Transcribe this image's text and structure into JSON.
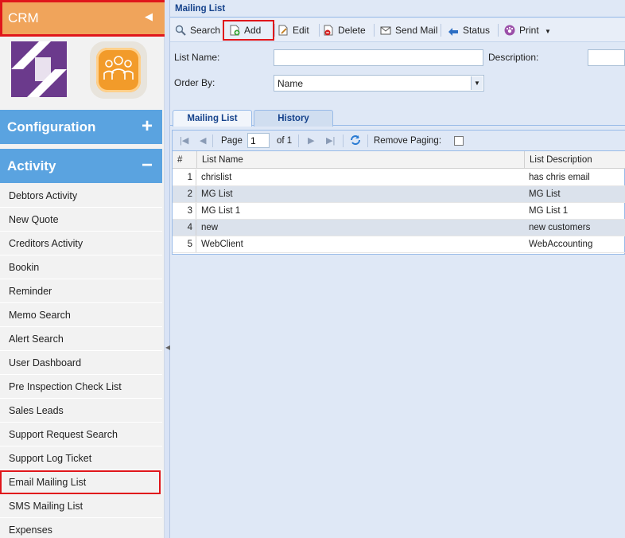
{
  "sidebar": {
    "crm_title": "CRM",
    "sections": [
      {
        "label": "Configuration",
        "sign": "+"
      },
      {
        "label": "Activity",
        "sign": "−"
      }
    ],
    "items": [
      "Debtors Activity",
      "New Quote",
      "Creditors Activity",
      "Bookin",
      "Reminder",
      "Memo Search",
      "Alert Search",
      "User Dashboard",
      "Pre Inspection Check List",
      "Sales Leads",
      "Support Request Search",
      "Support Log Ticket",
      "Email Mailing List",
      "SMS Mailing List",
      "Expenses"
    ]
  },
  "panel": {
    "title": "Mailing List"
  },
  "toolbar": {
    "search": "Search",
    "add": "Add",
    "edit": "Edit",
    "delete": "Delete",
    "send_mail": "Send Mail",
    "status": "Status",
    "print": "Print"
  },
  "form": {
    "list_name_label": "List Name:",
    "list_name_value": "",
    "description_label": "Description:",
    "description_value": "",
    "order_by_label": "Order By:",
    "order_by_value": "Name"
  },
  "tabs": [
    "Mailing List",
    "History"
  ],
  "paging": {
    "page_label": "Page",
    "page_value": "1",
    "of_label": "of 1",
    "remove_paging_label": "Remove Paging:"
  },
  "grid": {
    "columns": [
      "#",
      "List Name",
      "List Description"
    ],
    "rows": [
      {
        "num": "1",
        "name": "chrislist",
        "desc": "has chris email"
      },
      {
        "num": "2",
        "name": "MG List",
        "desc": "MG List"
      },
      {
        "num": "3",
        "name": "MG List 1",
        "desc": "MG List 1"
      },
      {
        "num": "4",
        "name": "new",
        "desc": "new customers"
      },
      {
        "num": "5",
        "name": "WebClient",
        "desc": "WebAccounting"
      }
    ]
  },
  "colors": {
    "crm_header": "#f0a45b",
    "section_header": "#5aa3e0",
    "highlight_border": "#e0161b",
    "panel_title": "#15428b"
  }
}
